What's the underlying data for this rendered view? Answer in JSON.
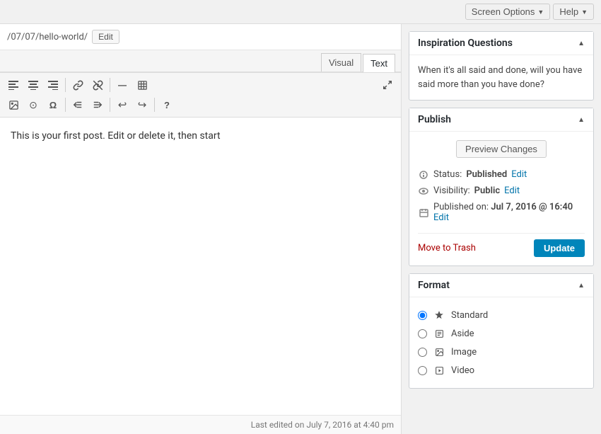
{
  "topbar": {
    "screen_options_label": "Screen Options",
    "help_label": "Help"
  },
  "permalink": {
    "url": "/07/07/hello-world/",
    "edit_label": "Edit"
  },
  "editor": {
    "visual_tab": "Visual",
    "text_tab": "Text",
    "active_tab": "Text",
    "content": "This is your first post. Edit or delete it, then start",
    "footer": "Last edited on July 7, 2016 at 4:40 pm"
  },
  "toolbar": {
    "row1": [
      {
        "name": "align-left-icon",
        "symbol": "≡",
        "title": "Align left"
      },
      {
        "name": "align-center-icon",
        "symbol": "≡",
        "title": "Align center"
      },
      {
        "name": "align-right-icon",
        "symbol": "≡",
        "title": "Align right"
      },
      {
        "name": "link-icon",
        "symbol": "🔗",
        "title": "Insert link"
      },
      {
        "name": "unlink-icon",
        "symbol": "⛓",
        "title": "Remove link"
      },
      {
        "name": "horizontal-rule-icon",
        "symbol": "—",
        "title": "Horizontal rule"
      },
      {
        "name": "table-icon",
        "symbol": "⊞",
        "title": "Table"
      },
      {
        "name": "fullscreen-icon",
        "symbol": "⛶",
        "title": "Fullscreen"
      }
    ],
    "row2": [
      {
        "name": "image-icon",
        "symbol": "🖼",
        "title": "Insert image"
      },
      {
        "name": "media-icon",
        "symbol": "⊙",
        "title": "Insert media"
      },
      {
        "name": "special-char-icon",
        "symbol": "Ω",
        "title": "Special characters"
      },
      {
        "name": "outdent-icon",
        "symbol": "⇤",
        "title": "Outdent"
      },
      {
        "name": "indent-icon",
        "symbol": "⇥",
        "title": "Indent"
      },
      {
        "name": "undo-icon",
        "symbol": "↩",
        "title": "Undo"
      },
      {
        "name": "redo-icon",
        "symbol": "↪",
        "title": "Redo"
      },
      {
        "name": "help-icon",
        "symbol": "?",
        "title": "Help"
      }
    ]
  },
  "inspiration": {
    "title": "Inspiration Questions",
    "text": "When it's all said and done, will you have said more than you have done?"
  },
  "publish": {
    "title": "Publish",
    "preview_label": "Preview Changes",
    "status_label": "Status:",
    "status_value": "Published",
    "status_edit": "Edit",
    "visibility_label": "Visibility:",
    "visibility_value": "Public",
    "visibility_edit": "Edit",
    "published_label": "Published on:",
    "published_value": "Jul 7, 2016 @ 16:40",
    "published_edit": "Edit",
    "trash_label": "Move to Trash",
    "update_label": "Update"
  },
  "format": {
    "title": "Format",
    "options": [
      {
        "value": "standard",
        "label": "Standard",
        "icon": "✦",
        "checked": true
      },
      {
        "value": "aside",
        "label": "Aside",
        "icon": "📄",
        "checked": false
      },
      {
        "value": "image",
        "label": "Image",
        "icon": "🖼",
        "checked": false
      },
      {
        "value": "video",
        "label": "Video",
        "icon": "▶",
        "checked": false
      }
    ]
  }
}
